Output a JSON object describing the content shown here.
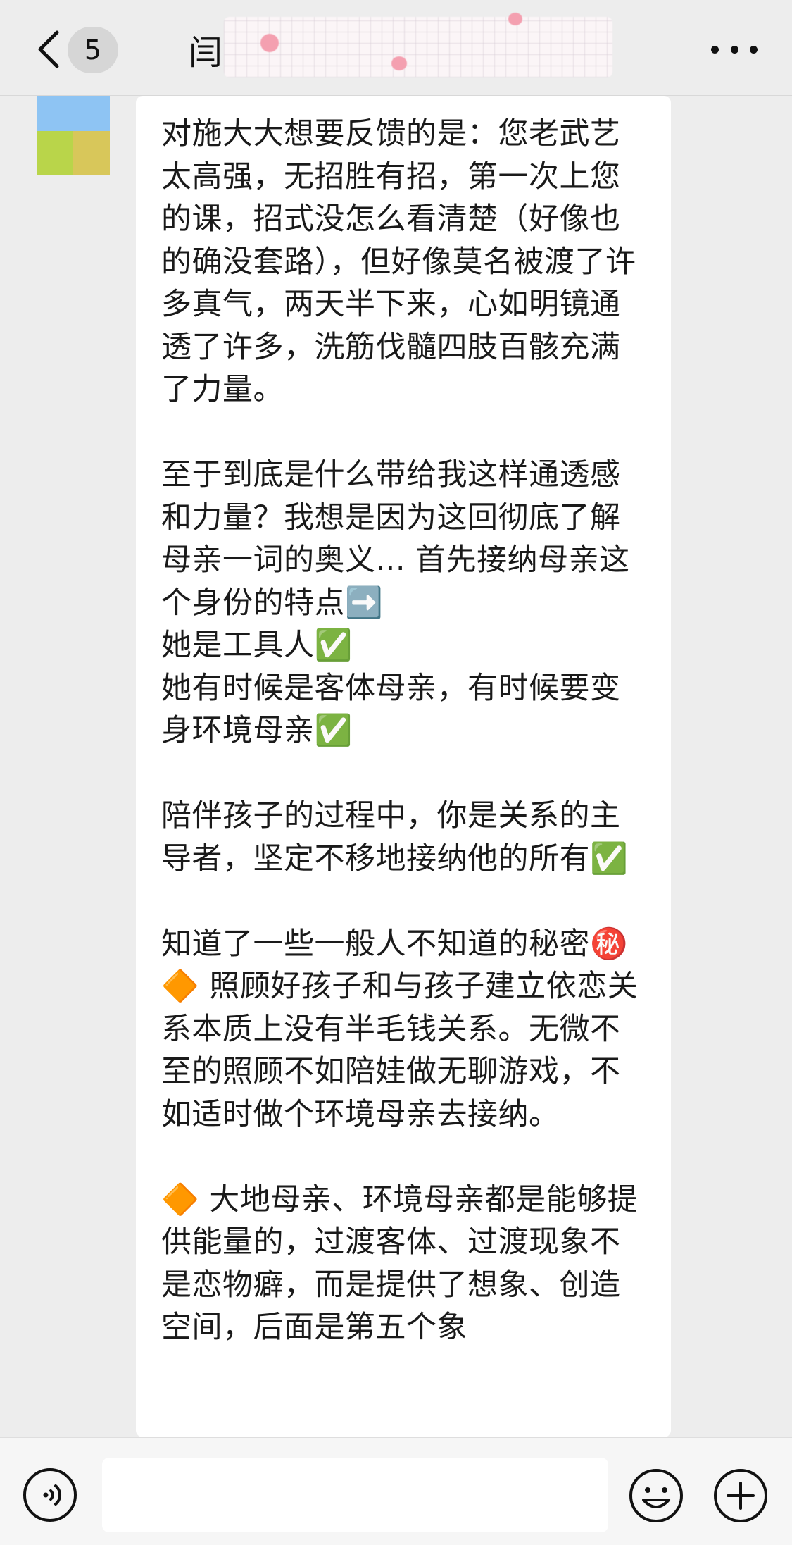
{
  "header": {
    "back_icon": "chevron-left-icon",
    "unread_count": "5",
    "title_visible": "闫",
    "more_icon": "more-dots-icon"
  },
  "message": {
    "text": "对施大大想要反馈的是：您老武艺太高强，无招胜有招，第一次上您的课，招式没怎么看清楚（好像也的确没套路），但好像莫名被渡了许多真气，两天半下来，心如明镜通透了许多，洗筋伐髓四肢百骸充满了力量。\n\n至于到底是什么带给我这样通透感和力量？我想是因为这回彻底了解母亲一词的奥义... 首先接纳母亲这个身份的特点➡️\n她是工具人✅\n她有时候是客体母亲，有时候要变身环境母亲✅\n\n陪伴孩子的过程中，你是关系的主导者，坚定不移地接纳他的所有✅\n\n知道了一些一般人不知道的秘密㊙️\n🔶 照顾好孩子和与孩子建立依恋关系本质上没有半毛钱关系。无微不至的照顾不如陪娃做无聊游戏，不如适时做个环境母亲去接纳。\n\n🔶 大地母亲、环境母亲都是能够提供能量的，过渡客体、过渡现象不是恋物癖，而是提供了想象、创造空间，后面是第五个象"
  },
  "input_bar": {
    "voice_icon": "voice-icon",
    "input_value": "",
    "emoji_icon": "emoji-icon",
    "plus_icon": "plus-icon"
  },
  "colors": {
    "background": "#ededed",
    "bubble": "#ffffff",
    "text": "#1a1a1a",
    "bar": "#f6f6f6"
  }
}
